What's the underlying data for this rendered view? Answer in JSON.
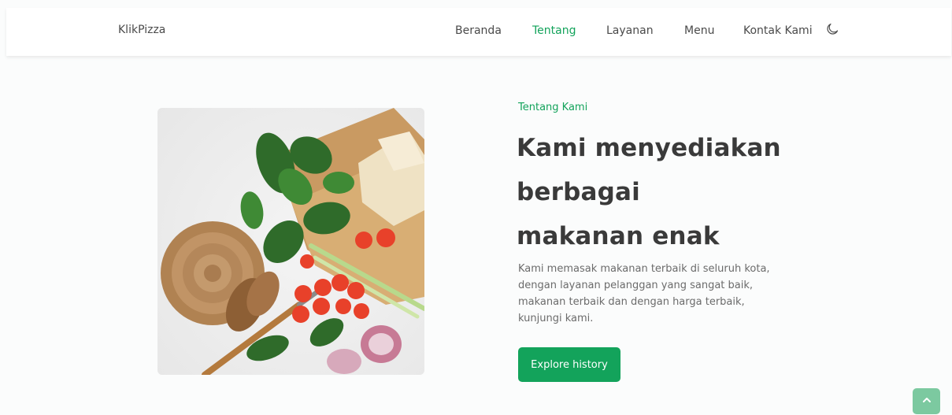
{
  "header": {
    "logo": "KlikPizza",
    "nav": [
      {
        "label": "Beranda",
        "active": false
      },
      {
        "label": "Tentang",
        "active": true
      },
      {
        "label": "Layanan",
        "active": false
      },
      {
        "label": "Menu",
        "active": false
      },
      {
        "label": "Kontak Kami",
        "active": false
      }
    ],
    "theme_icon": "moon-icon"
  },
  "about": {
    "eyebrow": "Tentang Kami",
    "title_lines": [
      "Kami menyediakan",
      "berbagai",
      "makanan enak"
    ],
    "description_lines": [
      "Kami memasak makanan terbaik di seluruh kota,",
      "dengan layanan pelanggan yang sangat baik,",
      "makanan terbaik dan dengan harga terbaik,",
      "kunjungi kami."
    ],
    "cta_label": "Explore history",
    "image": "food-ingredients-photo"
  },
  "back_to_top": {
    "icon": "chevron-up-icon"
  },
  "colors": {
    "accent": "#13a35b",
    "accent_light": "#7cc9a0",
    "text": "#3a3a3a"
  }
}
